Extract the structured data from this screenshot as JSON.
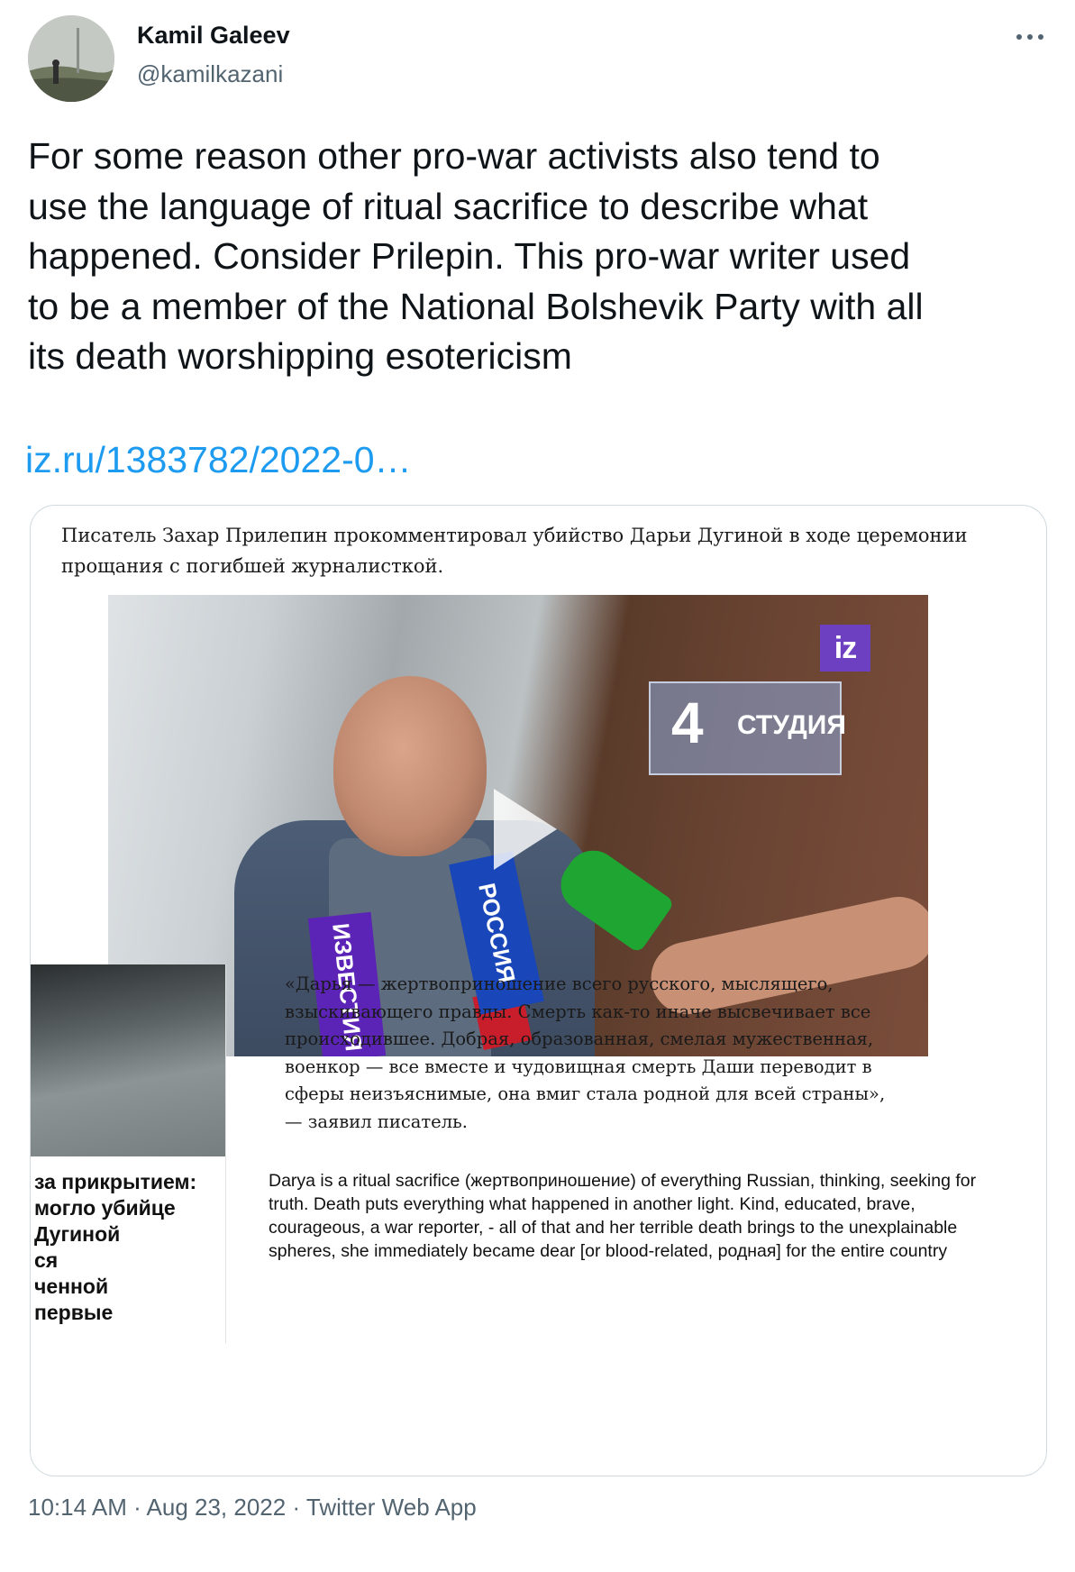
{
  "author": {
    "name": "Kamil Galeev",
    "handle": "@kamilkazani"
  },
  "tweet": {
    "text": "For some reason other pro-war activists also tend to\nuse the language of ritual sacrifice to describe what\nhappened. Consider Prilepin. This pro-war writer used\nto be a member of the National Bolshevik Party with all\nits death worshipping esotericism",
    "link": "iz.ru/1383782/2022-0…"
  },
  "media": {
    "article_lead": "Писатель Захар Прилепин прокомментировал убийство Дарьи Дугиной в ходе церемонии прощания с погибшей журналисткой.",
    "video": {
      "channel_logo": "iz",
      "studio_number": "4",
      "studio_label": "СТУДИЯ",
      "mic_izvestia": "ИЗВЕСТИЯ",
      "mic_russia": "РОССИЯ"
    },
    "sidebar_headline": "за прикрытием:\nмогло убийце\nДугиной\nся\nченной\nпервые",
    "quote_ru": "«Дарья — жертвоприношение всего русского, мыслящего,\nвзыскивающего правды. Смерть как-то иначе высвечивает все\nпроисходившее. Добрая, образованная, смелая мужественная,\nвоенкор — все вместе и чудовищная смерть Даши переводит в\nсферы неизъяснимые, она вмиг стала родной для всей страны»,\n— заявил писатель.",
    "translation_en": "Darya is a ritual sacrifice (жертвоприношение) of everything Russian, thinking, seeking for truth. Death puts everything what happened in another light. Kind, educated, brave, courageous, a war reporter, - all of that and her terrible death brings to the unexplainable spheres, she immediately became dear [or blood-related, родная] for the entire country"
  },
  "meta": {
    "time": "10:14 AM",
    "sep1": " · ",
    "date": "Aug 23, 2022",
    "sep2": " · ",
    "source": "Twitter Web App"
  },
  "colors": {
    "link": "#1d9bf0",
    "secondary_text": "#536471",
    "primary_text": "#0f1419"
  },
  "icons": {
    "more": "more-horizontal-icon",
    "play": "play-icon"
  }
}
